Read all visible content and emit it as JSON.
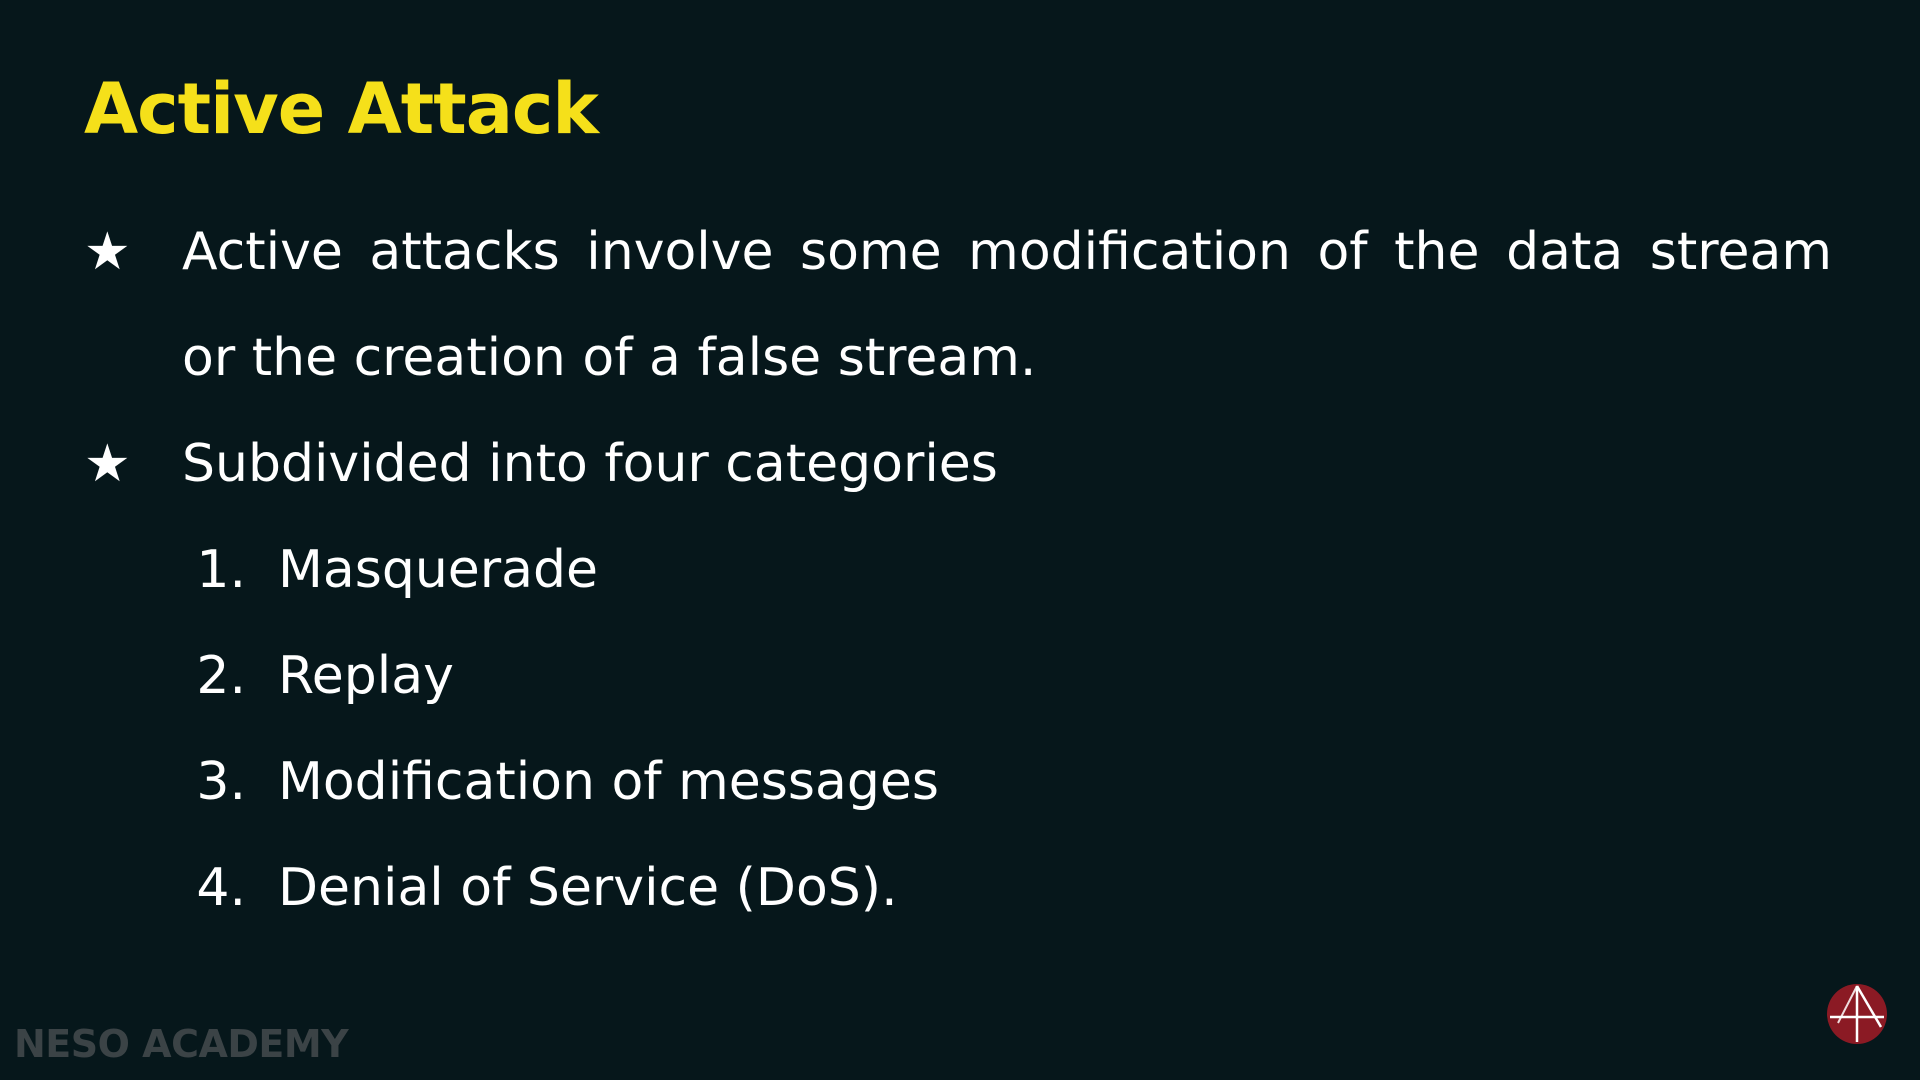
{
  "slide": {
    "title": "Active Attack",
    "bullets": [
      {
        "marker": "★",
        "lines": [
          "Active attacks involve some modification of the data stream",
          "or the creation of a false stream."
        ]
      },
      {
        "marker": "★",
        "lines": [
          "Subdivided into four categories"
        ]
      }
    ],
    "list_items": [
      {
        "number": "1.",
        "text": "Masquerade"
      },
      {
        "number": "2.",
        "text": "Replay"
      },
      {
        "number": "3.",
        "text": "Modification of messages"
      },
      {
        "number": "4.",
        "text": "Denial of Service (DoS)."
      }
    ],
    "watermark": "NESO ACADEMY"
  },
  "colors": {
    "background": "#06171b",
    "title": "#f5e01a",
    "text": "#ffffff",
    "watermark": "#3b4346",
    "logo": "#8b1a24"
  }
}
